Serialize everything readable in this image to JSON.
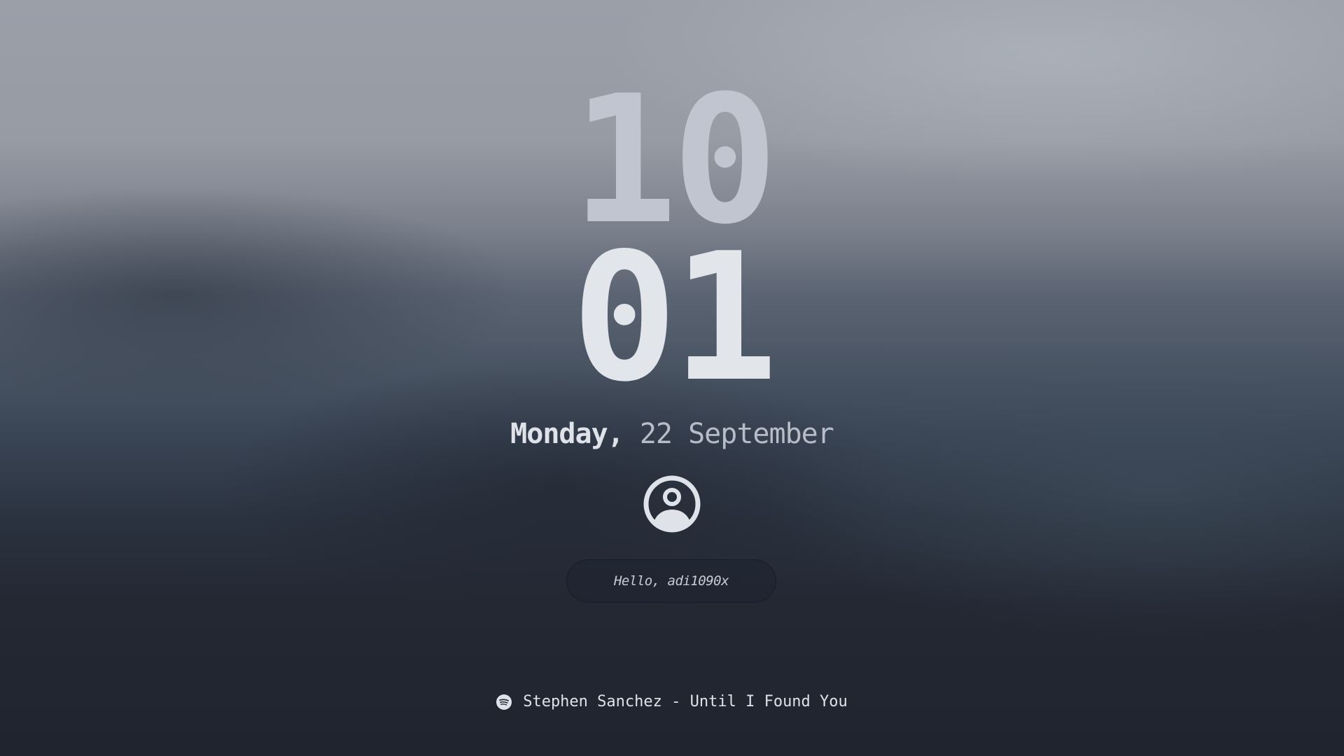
{
  "clock": {
    "hours": "10",
    "minutes": "01"
  },
  "date": {
    "weekday": "Monday,",
    "day_month": "22 September"
  },
  "user": {
    "avatar_icon": "user-circle-icon",
    "greeting": "Hello, adi1090x"
  },
  "media": {
    "icon": "spotify-icon",
    "track": "Stephen Sanchez - Until I Found You"
  },
  "colors": {
    "hours": "#c0c5d0",
    "minutes": "#e2e5ea",
    "text": "#dfe2e8",
    "input_bg": "#1e2430"
  }
}
